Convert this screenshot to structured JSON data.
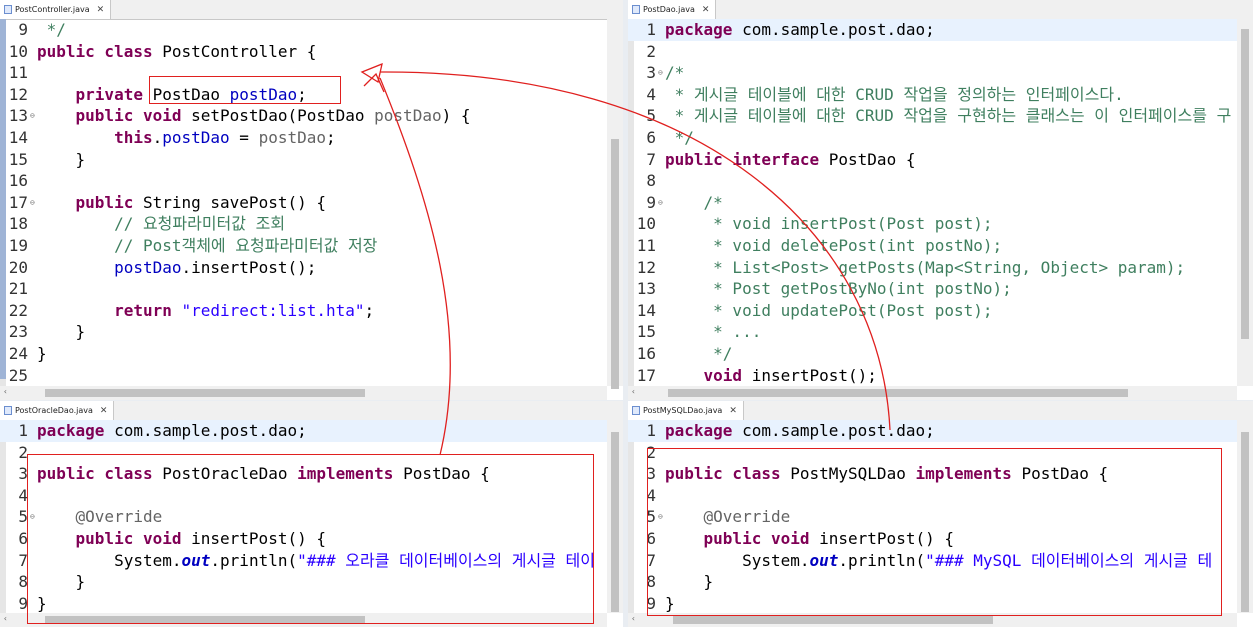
{
  "panes": {
    "controller": {
      "tab": "PostController.java",
      "lines": [
        {
          "n": "9",
          "t": [
            [
              "c",
              " */"
            ]
          ]
        },
        {
          "n": "10",
          "t": [
            [
              "k",
              "public class "
            ],
            [
              "",
              "PostController {"
            ]
          ]
        },
        {
          "n": "11",
          "t": []
        },
        {
          "n": "12",
          "t": [
            [
              "",
              "    "
            ],
            [
              "k",
              "private "
            ],
            [
              "",
              "PostDao "
            ],
            [
              "f",
              "postDao"
            ],
            [
              "",
              ";"
            ]
          ]
        },
        {
          "n": "13",
          "t": [
            [
              "",
              "    "
            ],
            [
              "k",
              "public void "
            ],
            [
              "",
              "setPostDao(PostDao "
            ],
            [
              "a",
              "postDao"
            ],
            [
              "",
              ") {"
            ]
          ]
        },
        {
          "n": "14",
          "t": [
            [
              "",
              "        "
            ],
            [
              "k",
              "this"
            ],
            [
              "",
              "."
            ],
            [
              "f",
              "postDao"
            ],
            [
              "",
              " = "
            ],
            [
              "a",
              "postDao"
            ],
            [
              "",
              ";"
            ]
          ]
        },
        {
          "n": "15",
          "t": [
            [
              "",
              "    }"
            ]
          ]
        },
        {
          "n": "16",
          "t": []
        },
        {
          "n": "17",
          "t": [
            [
              "",
              "    "
            ],
            [
              "k",
              "public "
            ],
            [
              "",
              "String savePost() {"
            ]
          ]
        },
        {
          "n": "18",
          "t": [
            [
              "",
              "        "
            ],
            [
              "c",
              "// 요청파라미터값 조회"
            ]
          ]
        },
        {
          "n": "19",
          "t": [
            [
              "",
              "        "
            ],
            [
              "c",
              "// Post객체에 요청파라미터값 저장"
            ]
          ]
        },
        {
          "n": "20",
          "t": [
            [
              "",
              "        "
            ],
            [
              "f",
              "postDao"
            ],
            [
              "",
              ".insertPost();"
            ]
          ]
        },
        {
          "n": "21",
          "t": []
        },
        {
          "n": "22",
          "t": [
            [
              "",
              "        "
            ],
            [
              "k",
              "return "
            ],
            [
              "s",
              "\"redirect:list.hta\""
            ],
            [
              "",
              ";"
            ]
          ]
        },
        {
          "n": "23",
          "t": [
            [
              "",
              "    }"
            ]
          ]
        },
        {
          "n": "24",
          "t": [
            [
              "",
              "}"
            ]
          ]
        },
        {
          "n": "25",
          "t": []
        }
      ]
    },
    "dao": {
      "tab": "PostDao.java",
      "lines": [
        {
          "n": "1",
          "t": [
            [
              "k",
              "package "
            ],
            [
              "",
              "com.sample.post.dao;"
            ]
          ]
        },
        {
          "n": "2",
          "t": []
        },
        {
          "n": "3",
          "t": [
            [
              "c",
              "/*"
            ]
          ]
        },
        {
          "n": "4",
          "t": [
            [
              "c",
              " * 게시글 테이블에 대한 CRUD 작업을 정의하는 인터페이스다."
            ]
          ]
        },
        {
          "n": "5",
          "t": [
            [
              "c",
              " * 게시글 테이블에 대한 CRUD 작업을 구현하는 클래스는 이 인터페이스를 구"
            ]
          ]
        },
        {
          "n": "6",
          "t": [
            [
              "c",
              " */"
            ]
          ]
        },
        {
          "n": "7",
          "t": [
            [
              "k",
              "public interface "
            ],
            [
              "",
              "PostDao {"
            ]
          ]
        },
        {
          "n": "8",
          "t": []
        },
        {
          "n": "9",
          "t": [
            [
              "",
              "    "
            ],
            [
              "c",
              "/*"
            ]
          ]
        },
        {
          "n": "10",
          "t": [
            [
              "c",
              "     * void insertPost(Post post);"
            ]
          ]
        },
        {
          "n": "11",
          "t": [
            [
              "c",
              "     * void deletePost(int postNo);"
            ]
          ]
        },
        {
          "n": "12",
          "t": [
            [
              "c",
              "     * List<Post> getPosts(Map<String, Object> param);"
            ]
          ]
        },
        {
          "n": "13",
          "t": [
            [
              "c",
              "     * Post getPostByNo(int postNo);"
            ]
          ]
        },
        {
          "n": "14",
          "t": [
            [
              "c",
              "     * void updatePost(Post post);"
            ]
          ]
        },
        {
          "n": "15",
          "t": [
            [
              "c",
              "     * ..."
            ]
          ]
        },
        {
          "n": "16",
          "t": [
            [
              "c",
              "     */"
            ]
          ]
        },
        {
          "n": "17",
          "t": [
            [
              "",
              "    "
            ],
            [
              "k",
              "void "
            ],
            [
              "",
              "insertPost();"
            ]
          ]
        }
      ]
    },
    "oracle": {
      "tab": "PostOracleDao.java",
      "lines": [
        {
          "n": "1",
          "t": [
            [
              "k",
              "package "
            ],
            [
              "",
              "com.sample.post.dao;"
            ]
          ]
        },
        {
          "n": "2",
          "t": []
        },
        {
          "n": "3",
          "t": [
            [
              "k",
              "public class "
            ],
            [
              "",
              "PostOracleDao "
            ],
            [
              "k",
              "implements "
            ],
            [
              "",
              "PostDao {"
            ]
          ]
        },
        {
          "n": "4",
          "t": []
        },
        {
          "n": "5",
          "t": [
            [
              "",
              "    "
            ],
            [
              "a",
              "@Override"
            ]
          ]
        },
        {
          "n": "6",
          "t": [
            [
              "",
              "    "
            ],
            [
              "k",
              "public void "
            ],
            [
              "",
              "insertPost() {"
            ]
          ]
        },
        {
          "n": "7",
          "t": [
            [
              "",
              "        System."
            ],
            [
              "fi",
              "out"
            ],
            [
              "",
              ".println("
            ],
            [
              "s",
              "\"### 오라클 데이터베이스의 게시글 테이"
            ]
          ]
        },
        {
          "n": "8",
          "t": [
            [
              "",
              "    }"
            ]
          ]
        },
        {
          "n": "9",
          "t": [
            [
              "",
              "}"
            ]
          ]
        }
      ]
    },
    "mysql": {
      "tab": "PostMySQLDao.java",
      "lines": [
        {
          "n": "1",
          "t": [
            [
              "k",
              "package "
            ],
            [
              "",
              "com.sample.post.dao;"
            ]
          ]
        },
        {
          "n": "2",
          "t": []
        },
        {
          "n": "3",
          "t": [
            [
              "k",
              "public class "
            ],
            [
              "",
              "PostMySQLDao "
            ],
            [
              "k",
              "implements "
            ],
            [
              "",
              "PostDao {"
            ]
          ]
        },
        {
          "n": "4",
          "t": []
        },
        {
          "n": "5",
          "t": [
            [
              "",
              "    "
            ],
            [
              "a",
              "@Override"
            ]
          ]
        },
        {
          "n": "6",
          "t": [
            [
              "",
              "    "
            ],
            [
              "k",
              "public void "
            ],
            [
              "",
              "insertPost() {"
            ]
          ]
        },
        {
          "n": "7",
          "t": [
            [
              "",
              "        System."
            ],
            [
              "fi",
              "out"
            ],
            [
              "",
              ".println("
            ],
            [
              "s",
              "\"### MySQL 데이터베이스의 게시글 테"
            ]
          ]
        },
        {
          "n": "8",
          "t": [
            [
              "",
              "    }"
            ]
          ]
        },
        {
          "n": "9",
          "t": [
            [
              "",
              "}"
            ]
          ]
        }
      ]
    }
  },
  "colors": {
    "keyword": "#7f0055",
    "string": "#2a00ff",
    "comment": "#3f7f5f",
    "field": "#0000c0",
    "annotation_marker": "#e0201f"
  },
  "icons": [
    "java-file-icon",
    "close-icon",
    "fold-toggle-icon"
  ]
}
